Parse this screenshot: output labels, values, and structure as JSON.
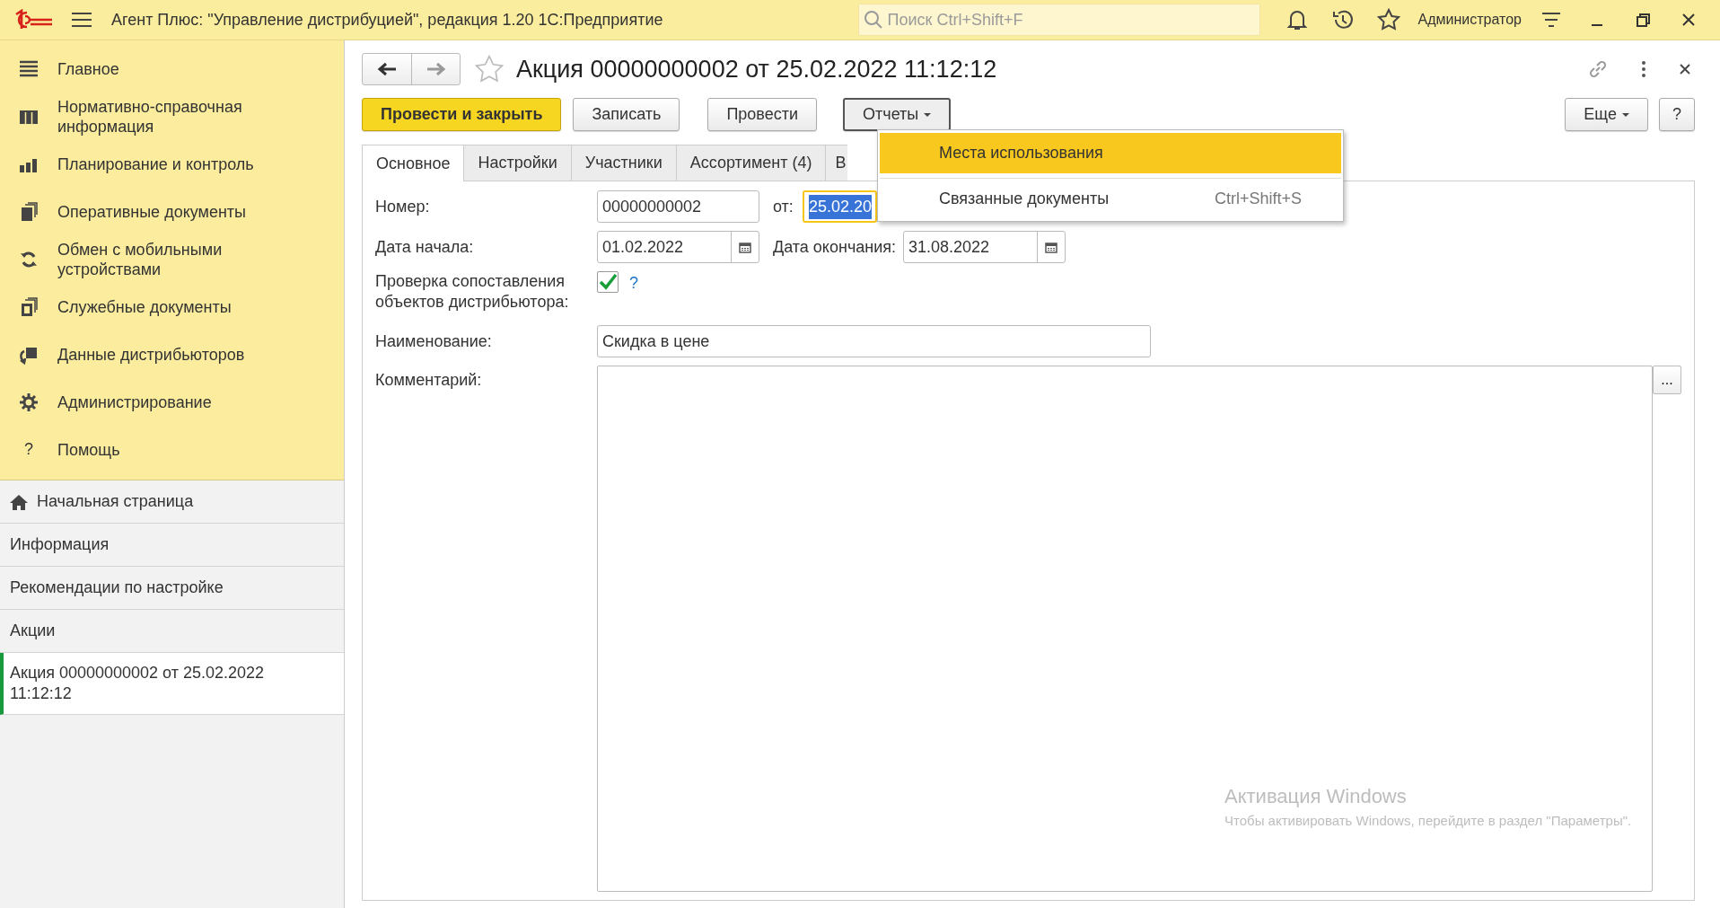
{
  "title_bar": {
    "title": "Агент Плюс: \"Управление дистрибуцией\", редакция 1.20 1С:Предприятие",
    "search": {
      "placeholder": "Поиск Ctrl+Shift+F"
    },
    "user": "Администратор"
  },
  "sections": [
    {
      "label": "Главное"
    },
    {
      "label": "Нормативно-справочная информация"
    },
    {
      "label": "Планирование и контроль"
    },
    {
      "label": "Оперативные документы"
    },
    {
      "label": "Обмен с мобильными устройствами"
    },
    {
      "label": "Служебные документы"
    },
    {
      "label": "Данные дистрибьюторов"
    },
    {
      "label": "Администрирование"
    },
    {
      "label": "Помощь",
      "glyph": "?"
    }
  ],
  "open_pages": [
    {
      "label": "Начальная страница",
      "selected": false
    },
    {
      "label": "Информация",
      "selected": false
    },
    {
      "label": "Рекомендации по настройке",
      "selected": false
    },
    {
      "label": "Акции",
      "selected": false
    },
    {
      "label": "Акция 00000000002 от 25.02.2022 11:12:12",
      "selected": true
    }
  ],
  "form": {
    "title": "Акция 00000000002 от 25.02.2022 11:12:12",
    "commands": [
      {
        "label": "Провести и закрыть",
        "kind": "primary"
      },
      {
        "label": "Записать",
        "kind": "plain"
      },
      {
        "label": "Провести",
        "kind": "plain"
      },
      {
        "label": "Отчеты",
        "kind": "menu",
        "expanded": true
      }
    ],
    "right_commands": [
      {
        "label": "Еще",
        "kind": "menu",
        "expanded": false
      },
      {
        "label": "?",
        "kind": "plain"
      }
    ],
    "menu": [
      {
        "label": "Места использования",
        "selected": true
      },
      {
        "label": "Связанные документы",
        "shortcut": "Ctrl+Shift+S",
        "selected": false
      }
    ],
    "tabs": [
      {
        "label": "Основное",
        "selected": true
      },
      {
        "label": "Настройки",
        "selected": false
      },
      {
        "label": "Участники",
        "selected": false
      },
      {
        "label": "Ассортимент (4)",
        "selected": false
      },
      {
        "label": "В",
        "selected": false
      }
    ],
    "number": {
      "label": "Номер:",
      "value": "00000000002"
    },
    "date": {
      "label": "от:",
      "value": "25.02.20",
      "focused": true
    },
    "start_date": {
      "label": "Дата начала:",
      "value": "01.02.2022"
    },
    "end_date": {
      "label": "Дата окончания:",
      "value": "31.08.2022"
    },
    "check": {
      "label": "Проверка сопоставления объектов дистрибьютора:",
      "checked": true,
      "help": "?"
    },
    "name": {
      "label": "Наименование:",
      "value": "Скидка в цене"
    },
    "comment": {
      "label": "Комментарий:",
      "button": "..."
    }
  },
  "watermark": {
    "title": "Активация Windows",
    "text": "Чтобы активировать Windows, перейдите в раздел \"Параметры\"."
  }
}
